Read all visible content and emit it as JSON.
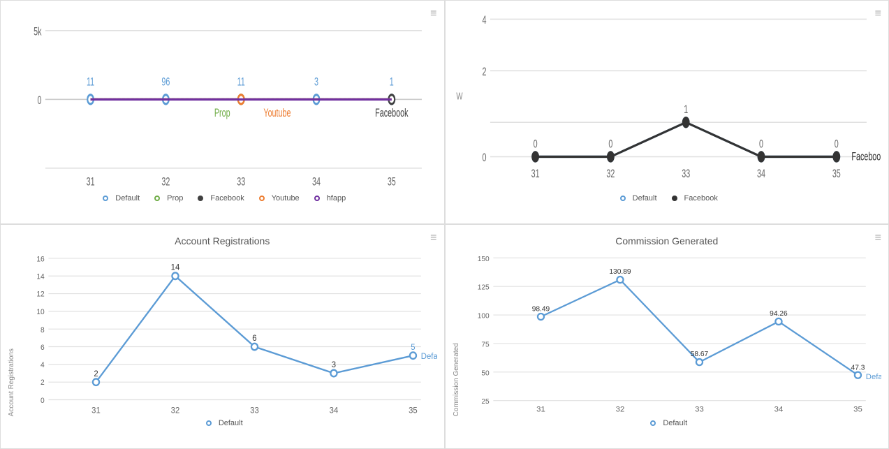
{
  "charts": {
    "topLeft": {
      "title": "",
      "yAxis": {
        "max": 5000,
        "ticks": [
          "5k",
          "0"
        ]
      },
      "xAxis": {
        "ticks": [
          31,
          32,
          33,
          34,
          35
        ]
      },
      "series": [
        {
          "name": "Default",
          "color": "#5b9bd5",
          "values": [
            0,
            0,
            0,
            0,
            0
          ],
          "labels": [
            "11",
            "96",
            "11",
            "3",
            "1"
          ]
        },
        {
          "name": "Prop",
          "color": "#70ad47",
          "values": [
            0,
            0,
            0,
            0,
            0
          ]
        },
        {
          "name": "Facebook",
          "color": "#404040",
          "values": [
            0,
            0,
            0,
            0,
            0
          ]
        },
        {
          "name": "Youtube",
          "color": "#ed7d31",
          "values": [
            0,
            0,
            0,
            0,
            0
          ]
        },
        {
          "name": "hfapp",
          "color": "#7030a0",
          "values": [
            0,
            0,
            0,
            0,
            0
          ]
        }
      ],
      "legend": [
        "Default",
        "Prop",
        "Facebook",
        "Youtube",
        "hfapp"
      ]
    },
    "topRight": {
      "title": "",
      "yAxis": {
        "max": 4,
        "ticks": [
          4,
          2,
          0
        ]
      },
      "xAxis": {
        "ticks": [
          31,
          32,
          33,
          34,
          35
        ]
      },
      "series": [
        {
          "name": "Default",
          "color": "#5b9bd5",
          "values": [
            0,
            0,
            1,
            0,
            0
          ],
          "labels": [
            "0",
            "0",
            "1",
            "0",
            "0"
          ]
        },
        {
          "name": "Facebook",
          "color": "#333",
          "values": [
            0,
            0,
            1,
            0,
            0
          ],
          "labels": [
            "0",
            "0",
            "1",
            "0",
            "0"
          ]
        }
      ],
      "legend": [
        "Default",
        "Facebook"
      ]
    },
    "bottomLeft": {
      "title": "Account Registrations",
      "yAxis": {
        "max": 16,
        "ticks": [
          16,
          14,
          12,
          10,
          8,
          6,
          4,
          2,
          0
        ]
      },
      "xAxis": {
        "ticks": [
          31,
          32,
          33,
          34,
          35
        ]
      },
      "series": [
        {
          "name": "Default",
          "color": "#5b9bd5",
          "values": [
            2,
            14,
            6,
            3,
            5
          ],
          "labels": [
            "2",
            "14",
            "6",
            "3",
            "5"
          ]
        }
      ],
      "yLabel": "Account Registrations",
      "legend": [
        "Default"
      ]
    },
    "bottomRight": {
      "title": "Commission Generated",
      "yAxis": {
        "max": 150,
        "ticks": [
          150,
          125,
          100,
          75,
          50,
          25
        ]
      },
      "xAxis": {
        "ticks": [
          31,
          32,
          33,
          34,
          35
        ]
      },
      "series": [
        {
          "name": "Default",
          "color": "#5b9bd5",
          "values": [
            98.49,
            130.89,
            58.67,
            94.26,
            47.3
          ],
          "labels": [
            "98.49",
            "130.89",
            "58.67",
            "94.26",
            "47.3"
          ]
        }
      ],
      "yLabel": "Commission Generated",
      "legend": [
        "Default"
      ]
    }
  },
  "icons": {
    "hamburger": "≡"
  }
}
